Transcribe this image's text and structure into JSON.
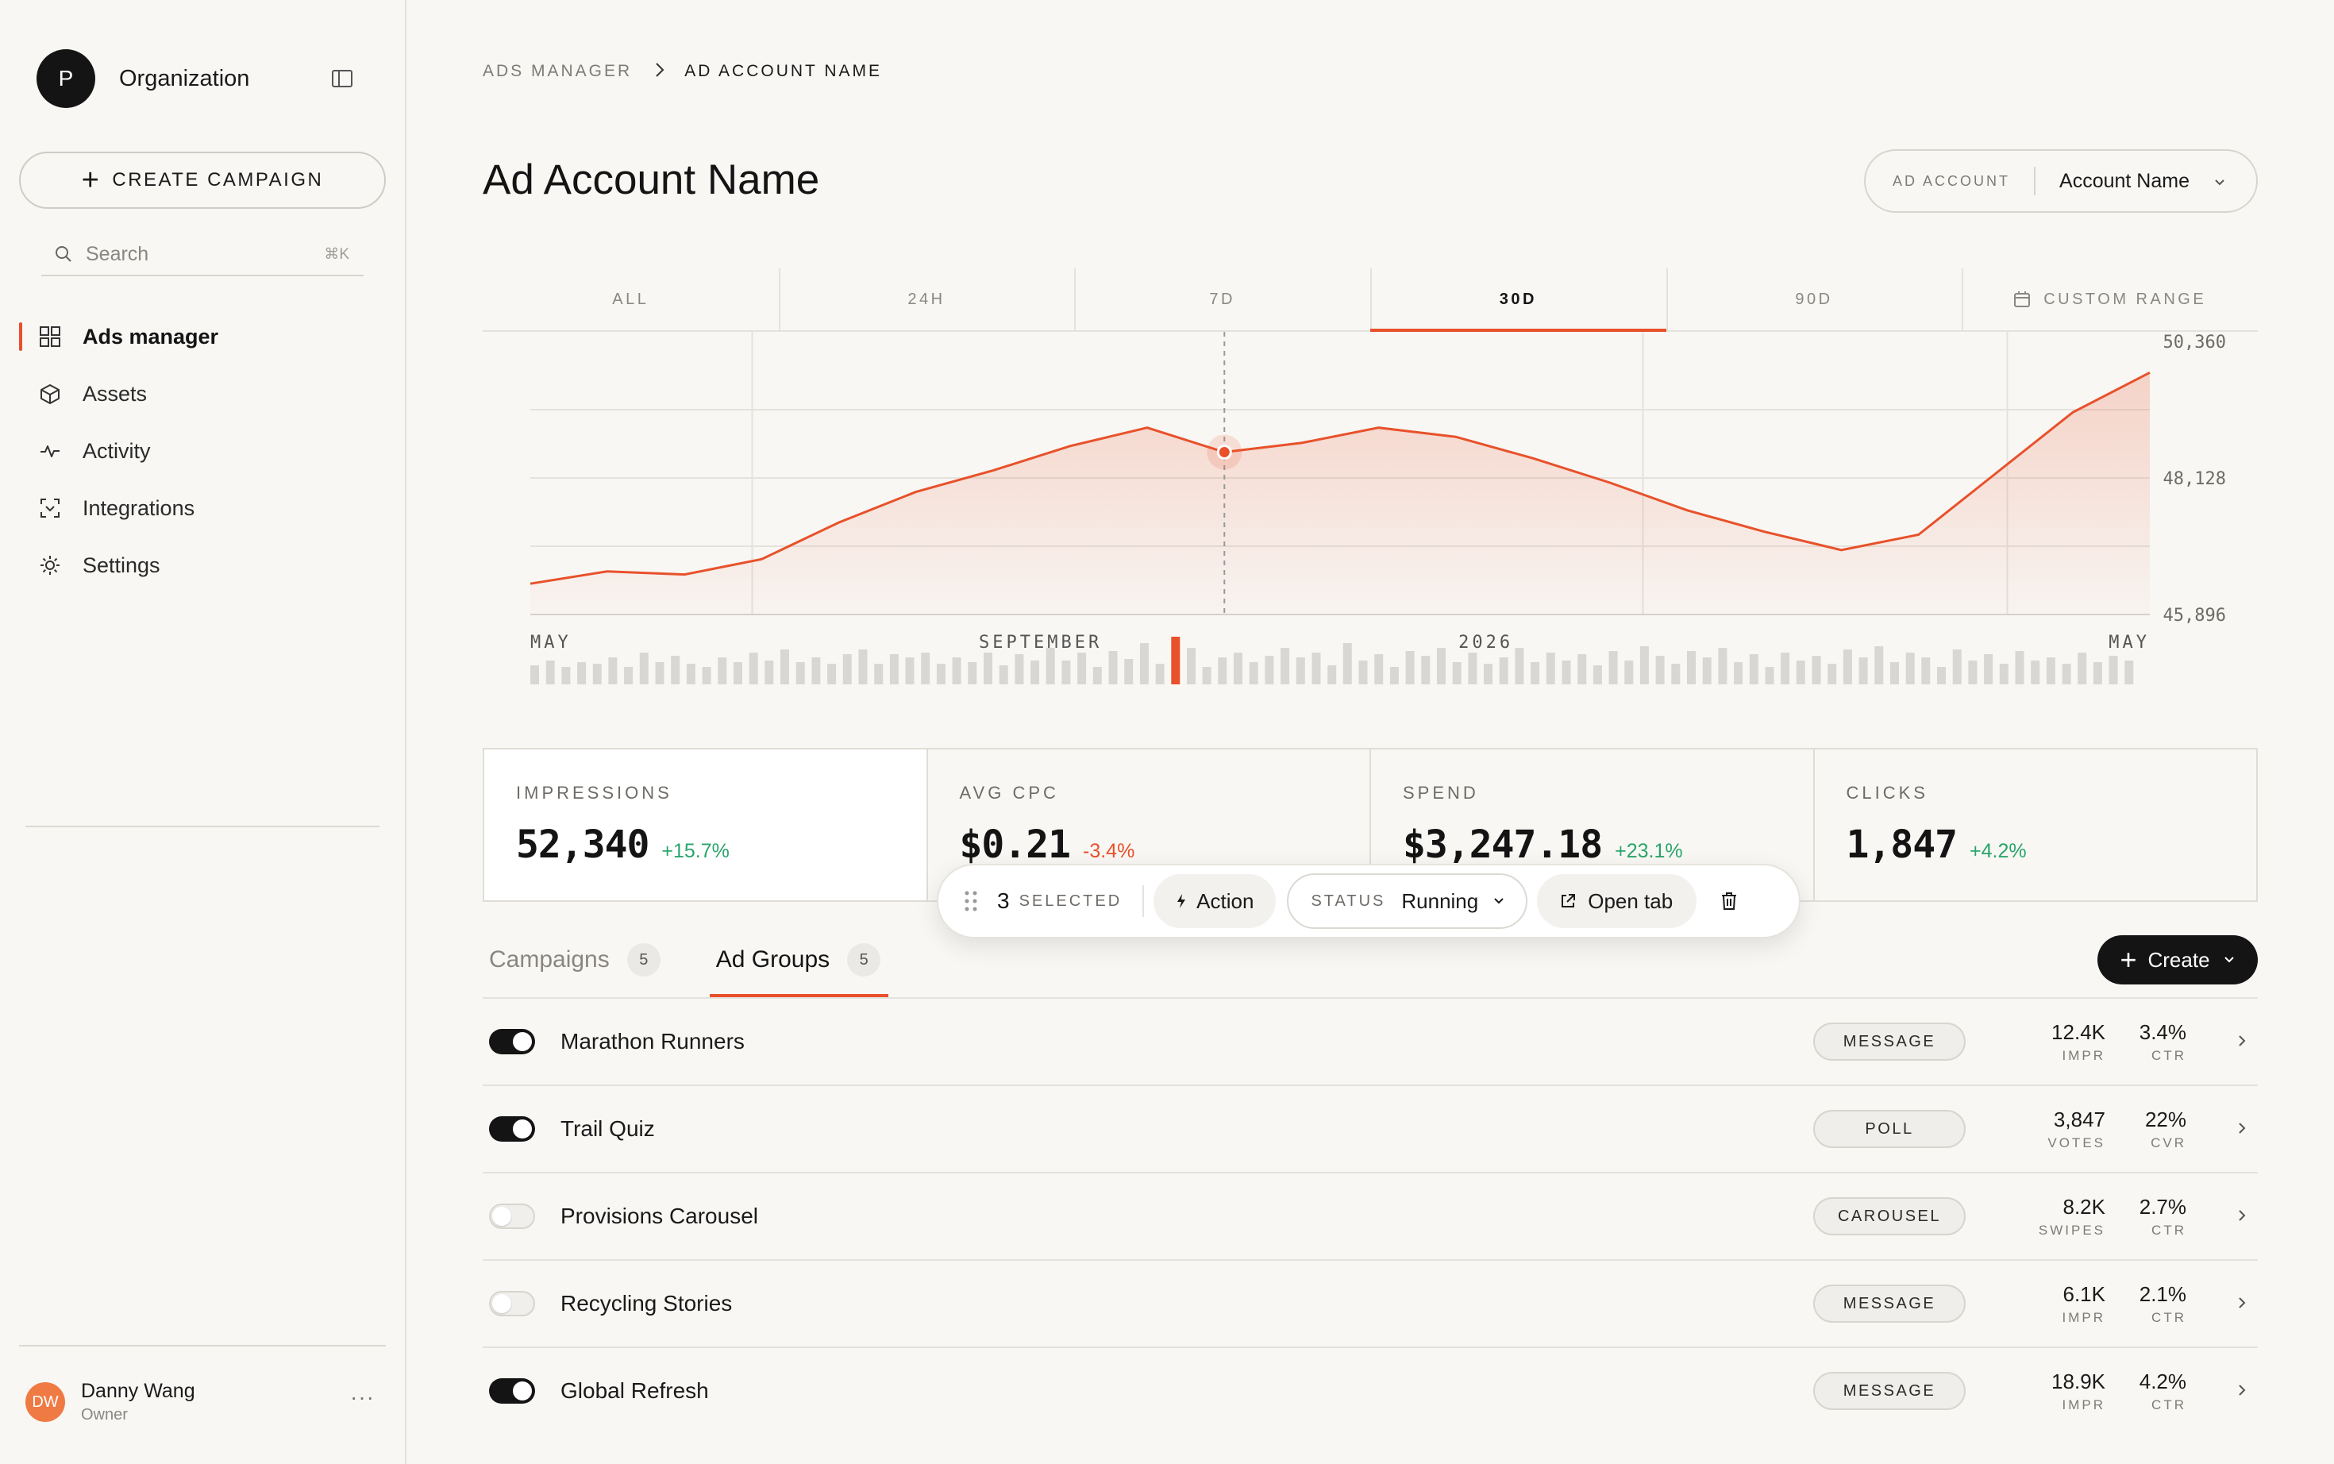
{
  "sidebar": {
    "org_initial": "P",
    "org_name": "Organization",
    "create_campaign": "CREATE CAMPAIGN",
    "search_placeholder": "Search",
    "search_shortcut": "⌘K",
    "nav": [
      {
        "label": "Ads manager",
        "icon": "grid-icon",
        "active": true
      },
      {
        "label": "Assets",
        "icon": "cube-icon",
        "active": false
      },
      {
        "label": "Activity",
        "icon": "activity-icon",
        "active": false
      },
      {
        "label": "Integrations",
        "icon": "integrations-icon",
        "active": false
      },
      {
        "label": "Settings",
        "icon": "gear-icon",
        "active": false
      }
    ],
    "user": {
      "initials": "DW",
      "name": "Danny Wang",
      "role": "Owner",
      "more": "···"
    }
  },
  "breadcrumb": {
    "root": "ADS MANAGER",
    "current": "AD ACCOUNT NAME"
  },
  "page_title": "Ad Account Name",
  "account_select": {
    "label": "AD ACCOUNT",
    "value": "Account Name"
  },
  "range_tabs": [
    {
      "label": "ALL",
      "active": false
    },
    {
      "label": "24H",
      "active": false
    },
    {
      "label": "7D",
      "active": false
    },
    {
      "label": "30D",
      "active": true
    },
    {
      "label": "90D",
      "active": false
    },
    {
      "label": "CUSTOM RANGE",
      "active": false
    }
  ],
  "colors": {
    "accent": "#e8512a",
    "positive": "#2aa56a",
    "dark": "#141414"
  },
  "chart_data": {
    "type": "area",
    "y_ticks": [
      "50,360",
      "48,128",
      "45,896"
    ],
    "ylim": [
      45896,
      50360
    ],
    "x_labels": [
      "MAY",
      "SEPTEMBER",
      "2026",
      "MAY"
    ],
    "series": [
      {
        "values": [
          46400,
          46600,
          46550,
          46800,
          47400,
          47900,
          48250,
          48650,
          48950,
          48550,
          48700,
          48950,
          48800,
          48450,
          48050,
          47600,
          47250,
          46950,
          47200,
          48200,
          49200,
          49850
        ]
      }
    ],
    "highlight_index": 9,
    "histogram": [
      24,
      30,
      22,
      28,
      26,
      34,
      22,
      40,
      28,
      36,
      26,
      22,
      34,
      28,
      40,
      30,
      44,
      28,
      34,
      26,
      38,
      44,
      26,
      38,
      34,
      40,
      26,
      34,
      28,
      40,
      24,
      38,
      30,
      46,
      30,
      40,
      22,
      42,
      32,
      52,
      26,
      38,
      46,
      22,
      34,
      40,
      28,
      36,
      46,
      34,
      40,
      24,
      52,
      30,
      38,
      22,
      42,
      36,
      46,
      28,
      40,
      26,
      34,
      46,
      28,
      40,
      30,
      38,
      24,
      42,
      30,
      48,
      36,
      26,
      42,
      34,
      46,
      28,
      38,
      22,
      40,
      30,
      36,
      26,
      44,
      34,
      48,
      28,
      40,
      34,
      22,
      44,
      30,
      38,
      26,
      42,
      30,
      34,
      26,
      40,
      28,
      36,
      30
    ],
    "highlight_bar": 41
  },
  "stats": [
    {
      "label": "IMPRESSIONS",
      "value": "52,340",
      "delta": "+15.7%",
      "trend": "pos",
      "active": true
    },
    {
      "label": "AVG CPC",
      "value": "$0.21",
      "delta": "-3.4%",
      "trend": "neg",
      "active": false
    },
    {
      "label": "SPEND",
      "value": "$3,247.18",
      "delta": "+23.1%",
      "trend": "pos",
      "active": false
    },
    {
      "label": "CLICKS",
      "value": "1,847",
      "delta": "+4.2%",
      "trend": "pos",
      "active": false
    }
  ],
  "selection_bar": {
    "count": "3",
    "selected_word": "SELECTED",
    "action_label": "Action",
    "status_label": "STATUS",
    "status_value": "Running",
    "open_tab_label": "Open tab"
  },
  "tabs": [
    {
      "label": "Campaigns",
      "count": "5",
      "active": false
    },
    {
      "label": "Ad Groups",
      "count": "5",
      "active": true
    }
  ],
  "create_button": "Create",
  "rows": [
    {
      "name": "Marathon Runners",
      "on": true,
      "type": "MESSAGE",
      "m1v": "12.4K",
      "m1l": "IMPR",
      "m2v": "3.4%",
      "m2l": "CTR"
    },
    {
      "name": "Trail Quiz",
      "on": true,
      "type": "POLL",
      "m1v": "3,847",
      "m1l": "VOTES",
      "m2v": "22%",
      "m2l": "CVR"
    },
    {
      "name": "Provisions Carousel",
      "on": false,
      "type": "CAROUSEL",
      "m1v": "8.2K",
      "m1l": "SWIPES",
      "m2v": "2.7%",
      "m2l": "CTR"
    },
    {
      "name": "Recycling Stories",
      "on": false,
      "type": "MESSAGE",
      "m1v": "6.1K",
      "m1l": "IMPR",
      "m2v": "2.1%",
      "m2l": "CTR"
    },
    {
      "name": "Global Refresh",
      "on": true,
      "type": "MESSAGE",
      "m1v": "18.9K",
      "m1l": "IMPR",
      "m2v": "4.2%",
      "m2l": "CTR"
    }
  ]
}
